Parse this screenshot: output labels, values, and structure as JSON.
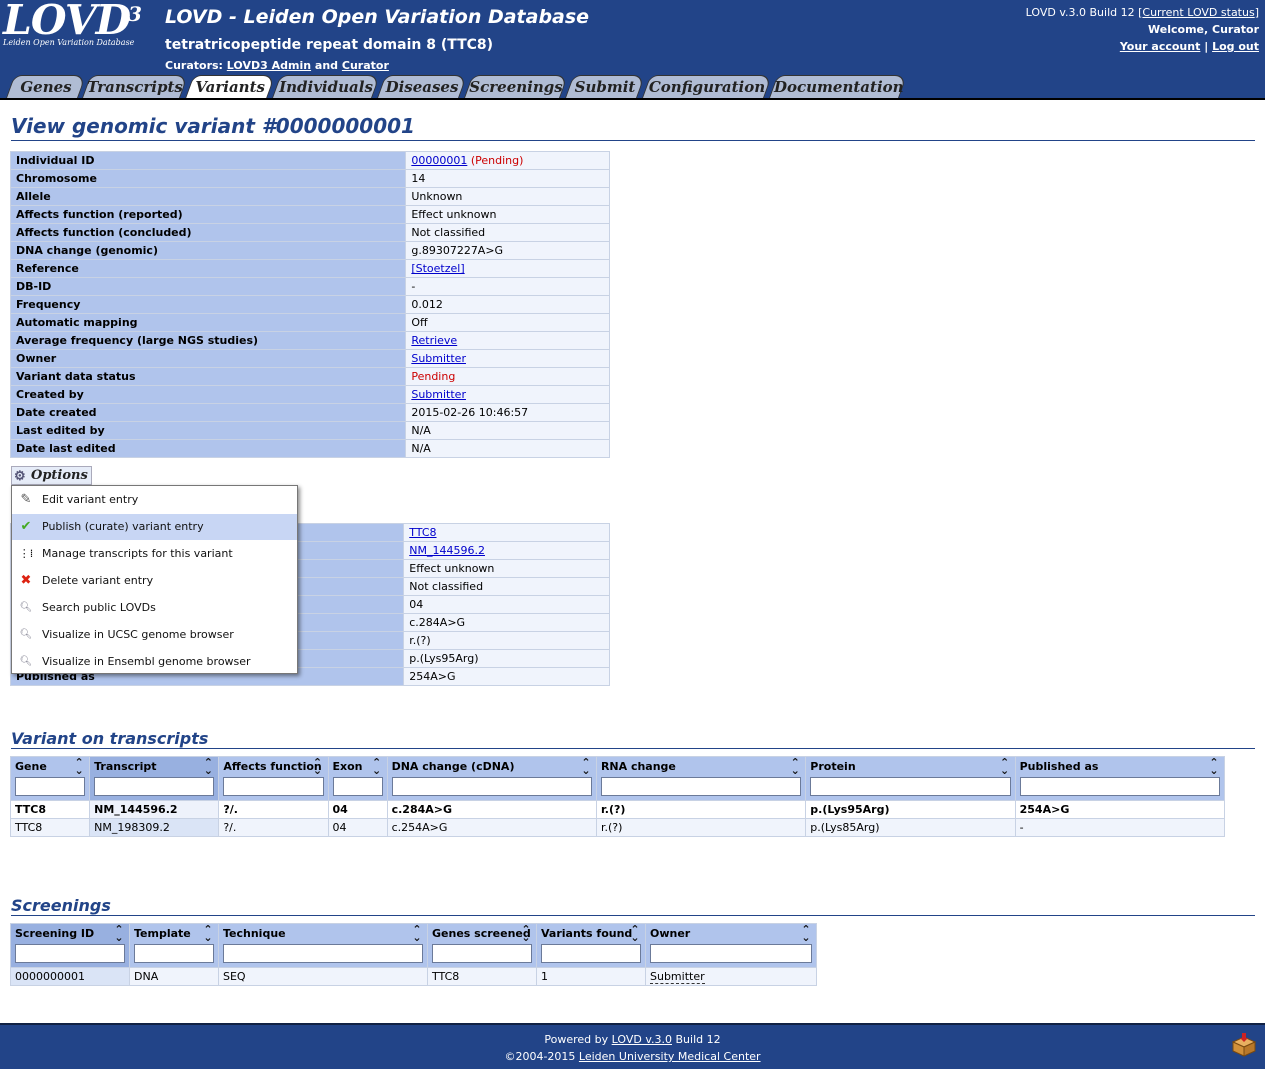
{
  "header": {
    "logo_text": "LOVD",
    "logo_sup": "3",
    "logo_sub": "Leiden Open Variation Database",
    "site_title": "LOVD - Leiden Open Variation Database",
    "gene_title": "tetratricopeptide repeat domain 8 (TTC8)",
    "curators_label": "Curators:",
    "curator1": "LOVD3 Admin",
    "curators_and": "and",
    "curator2": "Curator",
    "version_text": "LOVD v.3.0 Build 12 [",
    "status_link": "Current LOVD status",
    "version_close": "]",
    "welcome": "Welcome, Curator",
    "account_link": "Your account",
    "separator": "|",
    "logout_link": "Log out"
  },
  "tabs": [
    "Genes",
    "Transcripts",
    "Variants",
    "Individuals",
    "Diseases",
    "Screenings",
    "Submit",
    "Configuration",
    "Documentation"
  ],
  "page_title": "View genomic variant #0000000001",
  "variant": {
    "rows": [
      {
        "label": "Individual ID",
        "value": "00000001",
        "extra": "(Pending)"
      },
      {
        "label": "Chromosome",
        "value": "14"
      },
      {
        "label": "Allele",
        "value": "Unknown"
      },
      {
        "label": "Affects function (reported)",
        "value": "Effect unknown"
      },
      {
        "label": "Affects function (concluded)",
        "value": "Not classified"
      },
      {
        "label": "DNA change (genomic)",
        "value": "g.89307227A>G"
      },
      {
        "label": "Reference",
        "value": "[Stoetzel]"
      },
      {
        "label": "DB-ID",
        "value": "-"
      },
      {
        "label": "Frequency",
        "value": "0.012"
      },
      {
        "label": "Automatic mapping",
        "value": "Off"
      },
      {
        "label": "Average frequency (large NGS studies)",
        "value": "Retrieve"
      },
      {
        "label": "Owner",
        "value": "Submitter"
      },
      {
        "label": "Variant data status",
        "value": "Pending"
      },
      {
        "label": "Created by",
        "value": "Submitter"
      },
      {
        "label": "Date created",
        "value": "2015-02-26 10:46:57"
      },
      {
        "label": "Last edited by",
        "value": "N/A"
      },
      {
        "label": "Date last edited",
        "value": "N/A"
      }
    ]
  },
  "options": {
    "label": "Options",
    "items": [
      {
        "label": "Edit variant entry",
        "icon": "pencil-icon"
      },
      {
        "label": "Publish (curate) variant entry",
        "icon": "check-icon"
      },
      {
        "label": "Manage transcripts for this variant",
        "icon": "transcripts-icon"
      },
      {
        "label": "Delete variant entry",
        "icon": "cross-icon"
      },
      {
        "label": "Search public LOVDs",
        "icon": "magnifier-icon"
      },
      {
        "label": "Visualize in UCSC genome browser",
        "icon": "magnifier-icon"
      },
      {
        "label": "Visualize in Ensembl genome browser",
        "icon": "magnifier-icon"
      }
    ]
  },
  "transcript_detail": {
    "last_label": "Published as",
    "values": [
      "TTC8",
      "NM_144596.2",
      "Effect unknown",
      "Not classified",
      "04",
      "c.284A>G",
      "r.(?)",
      "p.(Lys95Arg)",
      "254A>G"
    ]
  },
  "transcripts_section": {
    "title": "Variant on transcripts",
    "columns": [
      "Gene",
      "Transcript",
      "Affects function",
      "Exon",
      "DNA change (cDNA)",
      "RNA change",
      "Protein",
      "Published as"
    ],
    "rows": [
      [
        "TTC8",
        "NM_144596.2",
        "?/.",
        "04",
        "c.284A>G",
        "r.(?)",
        "p.(Lys95Arg)",
        "254A>G"
      ],
      [
        "TTC8",
        "NM_198309.2",
        "?/.",
        "04",
        "c.254A>G",
        "r.(?)",
        "p.(Lys85Arg)",
        "-"
      ]
    ]
  },
  "screenings_section": {
    "title": "Screenings",
    "columns": [
      "Screening ID",
      "Template",
      "Technique",
      "Genes screened",
      "Variants found",
      "Owner"
    ],
    "rows": [
      [
        "0000000001",
        "DNA",
        "SEQ",
        "TTC8",
        "1",
        "Submitter"
      ]
    ]
  },
  "footer": {
    "powered_by": "Powered by",
    "lovd_link": "LOVD v.3.0",
    "build": "Build 12",
    "copyright": "©2004-2015",
    "lumc_link": "Leiden University Medical Center"
  },
  "colors": {
    "header_bg": "#224488",
    "tab_bg": "#b0bcd4",
    "th_bg": "#b0c4ec",
    "td_bg": "#f0f4fc",
    "pending": "#cc0000"
  }
}
